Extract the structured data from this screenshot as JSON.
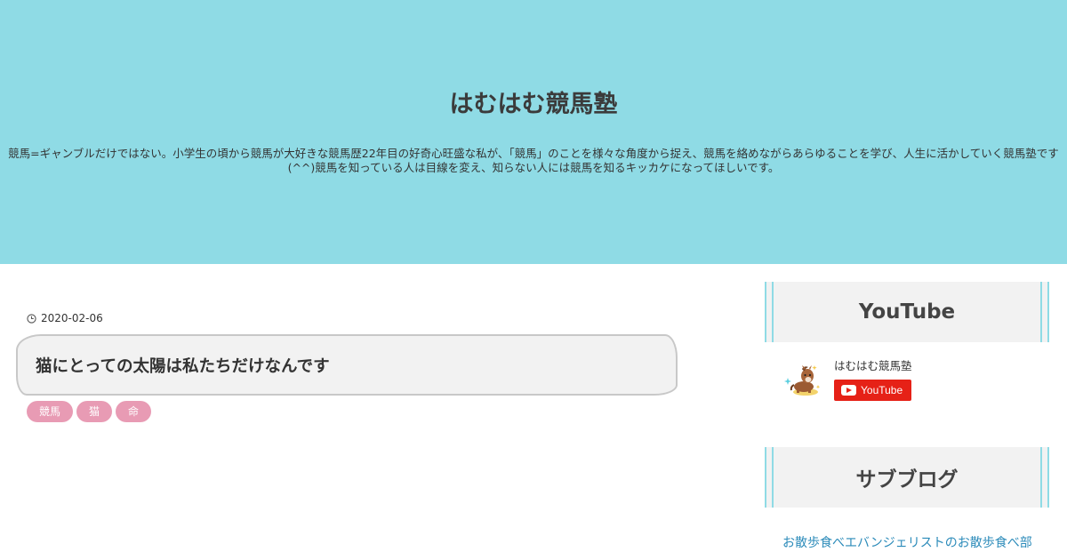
{
  "header": {
    "site_title": "はむはむ競馬塾",
    "description": "競馬=ギャンブルだけではない。小学生の頃から競馬が大好きな競馬歴22年目の好奇心旺盛な私が、「競馬」のことを様々な角度から捉え、競馬を絡めながらあらゆることを学び、人生に活かしていく競馬塾です(^^)競馬を知っている人は目線を変え、知らない人には競馬を知るキッカケになってほしいです。",
    "background_color": "#8fdbe5"
  },
  "article": {
    "date_icon": "clock-icon",
    "date": "2020-02-06",
    "title": "猫にとっての太陽は私たちだけなんです",
    "tags": [
      {
        "label": "競馬"
      },
      {
        "label": "猫"
      },
      {
        "label": "命"
      }
    ],
    "tag_color": "#e89bb4"
  },
  "sidebar": {
    "youtube_widget": {
      "heading": "YouTube",
      "channel_name": "はむはむ競馬塾",
      "subscribe_label": "YouTube",
      "avatar_icon": "horse-avatar-icon",
      "button_color": "#e62117"
    },
    "sub_blog_widget": {
      "heading": "サブブログ",
      "link_text": "お散歩食べエバンジェリストのお散歩食べ部"
    }
  }
}
